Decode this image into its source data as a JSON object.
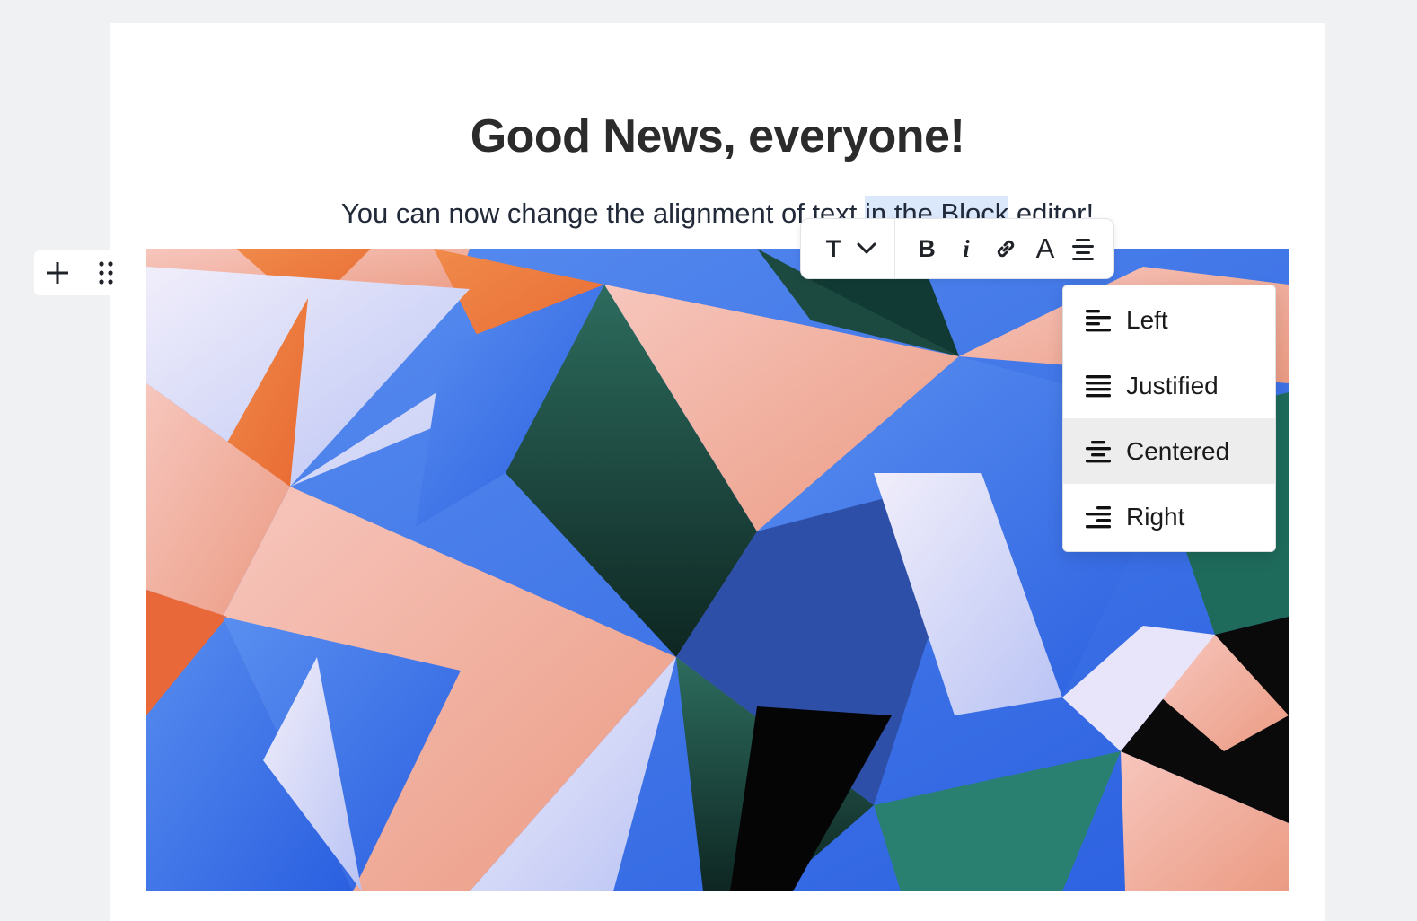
{
  "document": {
    "title": "Good News, everyone!",
    "subtitle_before": "You can now change the alignment of text ",
    "subtitle_highlight": "in the Block",
    "subtitle_after": " editor!"
  },
  "toolbar": {
    "text_style_icon": "T",
    "bold_label": "B",
    "italic_label": "i",
    "text_color_label": "A",
    "icons": [
      "text-style-icon",
      "chevron-down-icon",
      "bold-icon",
      "italic-icon",
      "link-icon",
      "text-color-icon",
      "align-center-icon"
    ]
  },
  "alignment_menu": {
    "selected": "Centered",
    "items": [
      {
        "label": "Left",
        "icon": "align-left-icon"
      },
      {
        "label": "Justified",
        "icon": "align-justify-icon"
      },
      {
        "label": "Centered",
        "icon": "align-center-icon"
      },
      {
        "label": "Right",
        "icon": "align-right-icon"
      }
    ]
  },
  "block_controls": {
    "icons": [
      "plus-icon",
      "drag-handle-icon"
    ]
  },
  "colors": {
    "highlight": "#dbe8fb",
    "menu_active": "#ededee",
    "page_background": "#f0f1f3"
  }
}
